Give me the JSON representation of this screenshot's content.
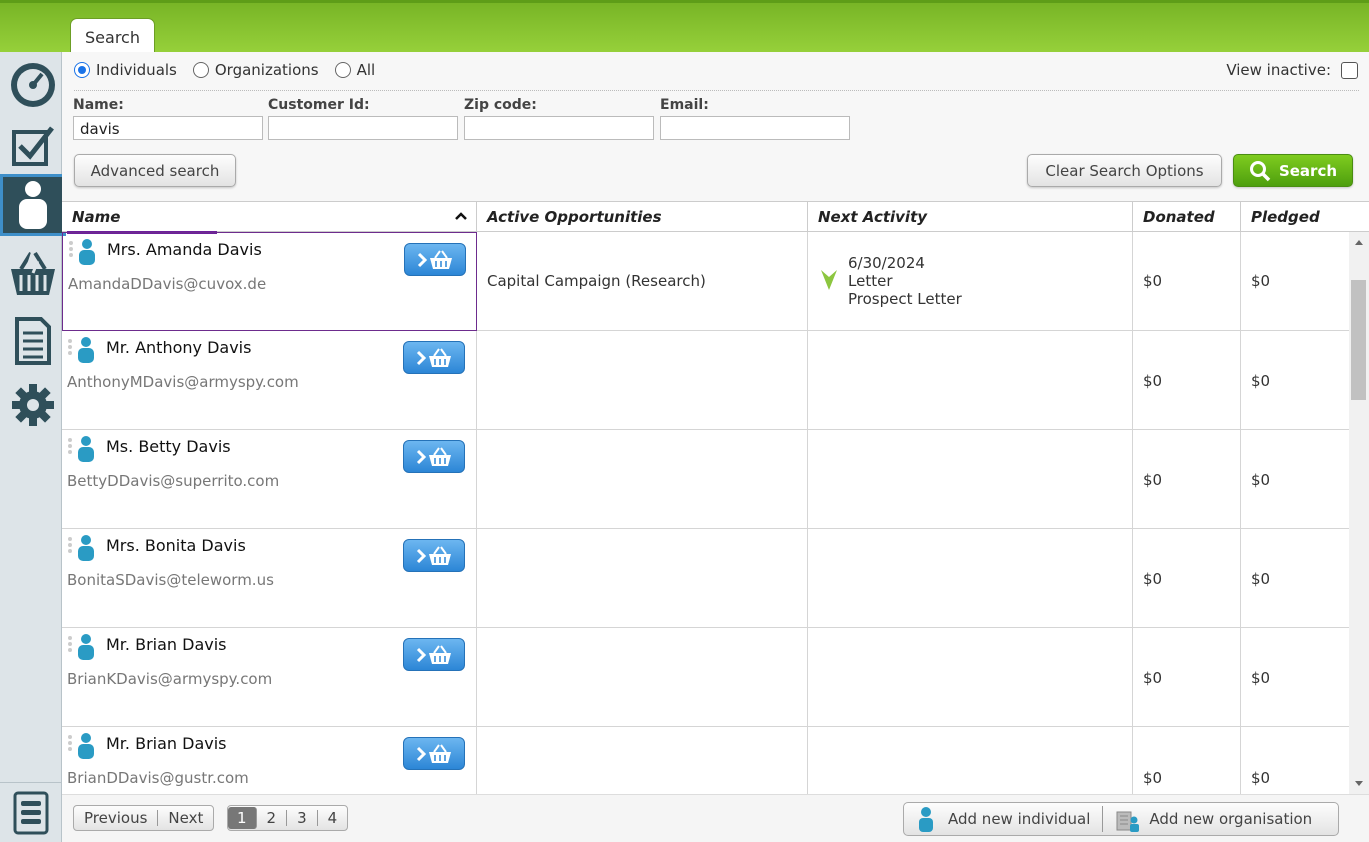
{
  "tabs": {
    "active": "Search"
  },
  "filters": {
    "entity_types": [
      {
        "label": "Individuals",
        "selected": true
      },
      {
        "label": "Organizations",
        "selected": false
      },
      {
        "label": "All",
        "selected": false
      }
    ],
    "view_inactive_label": "View inactive:",
    "fields": {
      "name": {
        "label": "Name:",
        "value": "davis"
      },
      "customer_id": {
        "label": "Customer Id:",
        "value": ""
      },
      "zip": {
        "label": "Zip code:",
        "value": ""
      },
      "email": {
        "label": "Email:",
        "value": ""
      }
    },
    "advanced_label": "Advanced search",
    "clear_label": "Clear Search Options",
    "search_label": "Search"
  },
  "columns": {
    "name": "Name",
    "opportunities": "Active Opportunities",
    "activity": "Next Activity",
    "donated": "Donated",
    "pledged": "Pledged"
  },
  "rows": [
    {
      "name": "Mrs. Amanda Davis",
      "email": "AmandaDDavis@cuvox.de",
      "opportunity": "Capital Campaign (Research)",
      "activity_date": "6/30/2024",
      "activity_type": "Letter",
      "activity_desc": "Prospect Letter",
      "donated": "$0",
      "pledged": "$0"
    },
    {
      "name": "Mr. Anthony Davis",
      "email": "AnthonyMDavis@armyspy.com",
      "opportunity": "",
      "activity_date": "",
      "activity_type": "",
      "activity_desc": "",
      "donated": "$0",
      "pledged": "$0"
    },
    {
      "name": "Ms. Betty Davis",
      "email": "BettyDDavis@superrito.com",
      "opportunity": "",
      "activity_date": "",
      "activity_type": "",
      "activity_desc": "",
      "donated": "$0",
      "pledged": "$0"
    },
    {
      "name": "Mrs. Bonita Davis",
      "email": "BonitaSDavis@teleworm.us",
      "opportunity": "",
      "activity_date": "",
      "activity_type": "",
      "activity_desc": "",
      "donated": "$0",
      "pledged": "$0"
    },
    {
      "name": "Mr. Brian Davis",
      "email": "BrianKDavis@armyspy.com",
      "opportunity": "",
      "activity_date": "",
      "activity_type": "",
      "activity_desc": "",
      "donated": "$0",
      "pledged": "$0"
    },
    {
      "name": "Mr. Brian Davis",
      "email": "BrianDDavis@gustr.com",
      "opportunity": "",
      "activity_date": "",
      "activity_type": "",
      "activity_desc": "",
      "donated": "$0",
      "pledged": "$0"
    }
  ],
  "pagination": {
    "previous": "Previous",
    "next": "Next",
    "pages": [
      "1",
      "2",
      "3",
      "4"
    ],
    "current": "1"
  },
  "actions": {
    "add_individual": "Add new individual",
    "add_organisation": "Add new organisation"
  },
  "colors": {
    "brand_green": "#78b526",
    "accent_blue": "#2c86d6",
    "sidebar_active": "#2f4f5a"
  }
}
